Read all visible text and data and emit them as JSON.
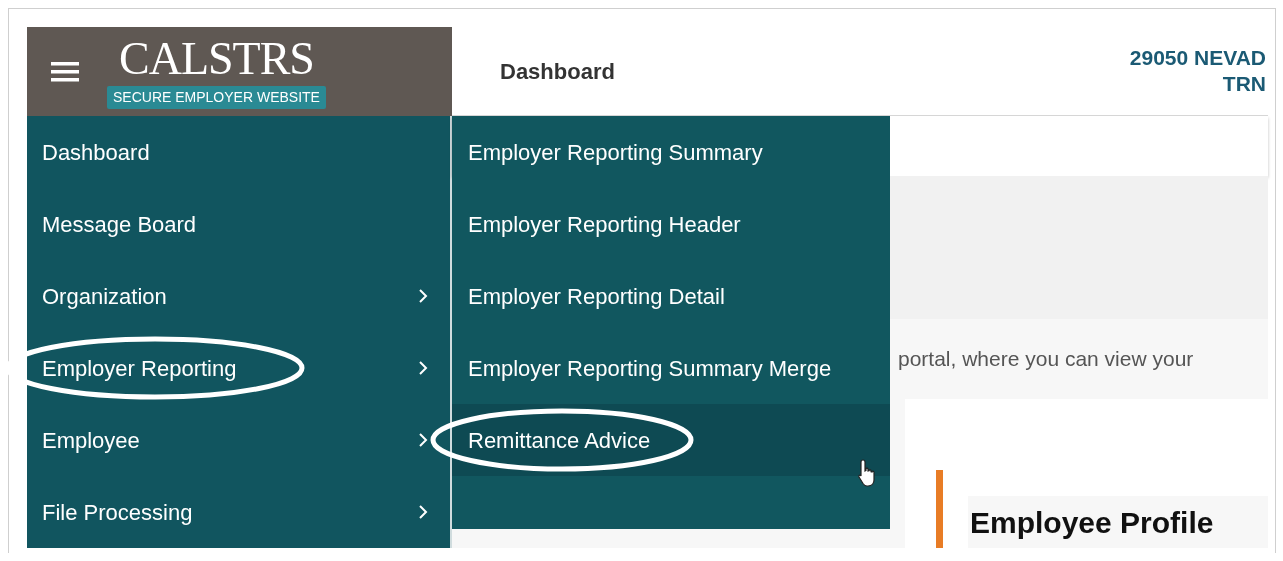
{
  "logo": {
    "name": "CALSTRS",
    "tagline": "SECURE EMPLOYER WEBSITE"
  },
  "header": {
    "title": "Dashboard",
    "address_lines": [
      "29050 NEVAD",
      "TRN"
    ]
  },
  "sidebar": {
    "items": [
      {
        "label": "Dashboard",
        "has_submenu": false,
        "circled": false
      },
      {
        "label": "Message Board",
        "has_submenu": false,
        "circled": false
      },
      {
        "label": "Organization",
        "has_submenu": true,
        "circled": false
      },
      {
        "label": "Employer Reporting",
        "has_submenu": true,
        "circled": true
      },
      {
        "label": "Employee",
        "has_submenu": true,
        "circled": false
      },
      {
        "label": "File Processing",
        "has_submenu": true,
        "circled": false
      }
    ]
  },
  "submenu": {
    "items": [
      {
        "label": "Employer Reporting Summary",
        "hovered": false,
        "circled": false
      },
      {
        "label": "Employer Reporting Header",
        "hovered": false,
        "circled": false
      },
      {
        "label": "Employer Reporting Detail",
        "hovered": false,
        "circled": false
      },
      {
        "label": "Employer Reporting Summary Merge",
        "hovered": false,
        "circled": false
      },
      {
        "label": "Remittance Advice",
        "hovered": true,
        "circled": true
      }
    ]
  },
  "content": {
    "intro": "portal, where you can view your",
    "card_title": "Employee Profile"
  }
}
